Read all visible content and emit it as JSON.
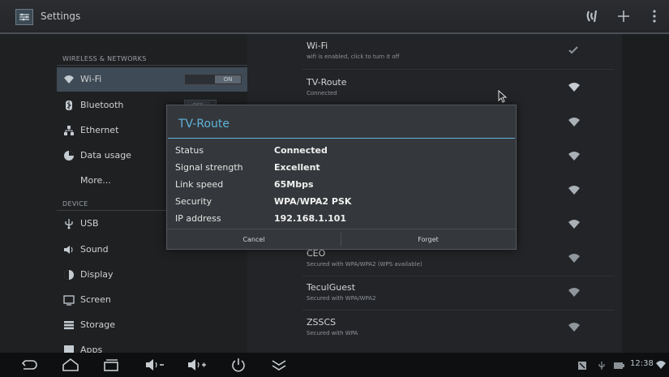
{
  "app": {
    "title": "Settings"
  },
  "colors": {
    "accent": "#5fb4dc",
    "selected": "#3e4a55"
  },
  "left_panel": {
    "sections": [
      {
        "header": "WIRELESS & NETWORKS"
      },
      {
        "header": "DEVICE"
      }
    ],
    "items": [
      {
        "label": "Wi-Fi",
        "icon": "wifi-icon",
        "toggle": "ON"
      },
      {
        "label": "Bluetooth",
        "icon": "bluetooth-icon",
        "toggle": "OFF"
      },
      {
        "label": "Ethernet",
        "icon": "ethernet-icon"
      },
      {
        "label": "Data usage",
        "icon": "data-usage-icon"
      },
      {
        "label": "More..."
      },
      {
        "label": "USB",
        "icon": "usb-icon"
      },
      {
        "label": "Sound",
        "icon": "sound-icon"
      },
      {
        "label": "Display",
        "icon": "display-icon"
      },
      {
        "label": "Screen",
        "icon": "screen-icon"
      },
      {
        "label": "Storage",
        "icon": "storage-icon"
      },
      {
        "label": "Apps",
        "icon": "apps-icon"
      }
    ]
  },
  "wifi_list": [
    {
      "name": "Wi-Fi",
      "sub": "wifi is enabled, click to turn it off",
      "icon": "check-icon"
    },
    {
      "name": "TV-Route",
      "sub": "Connected",
      "icon": "wifi-signal-icon"
    },
    {
      "name": "CEO",
      "sub": "Secured with WPA/WPA2 (WPS available)",
      "icon": "wifi-signal-icon"
    },
    {
      "name": "TeculGuest",
      "sub": "Secured with WPA/WPA2",
      "icon": "wifi-signal-icon"
    },
    {
      "name": "ZSSCS",
      "sub": "Secured with WPA",
      "icon": "wifi-signal-icon"
    }
  ],
  "dialog": {
    "title": "TV-Route",
    "rows": [
      {
        "key": "Status",
        "value": "Connected"
      },
      {
        "key": "Signal strength",
        "value": "Excellent"
      },
      {
        "key": "Link speed",
        "value": "65Mbps"
      },
      {
        "key": "Security",
        "value": "WPA/WPA2 PSK"
      },
      {
        "key": "IP address",
        "value": "192.168.1.101"
      }
    ],
    "cancel_label": "Cancel",
    "forget_label": "Forget"
  },
  "status_bar": {
    "time": "12:38"
  }
}
